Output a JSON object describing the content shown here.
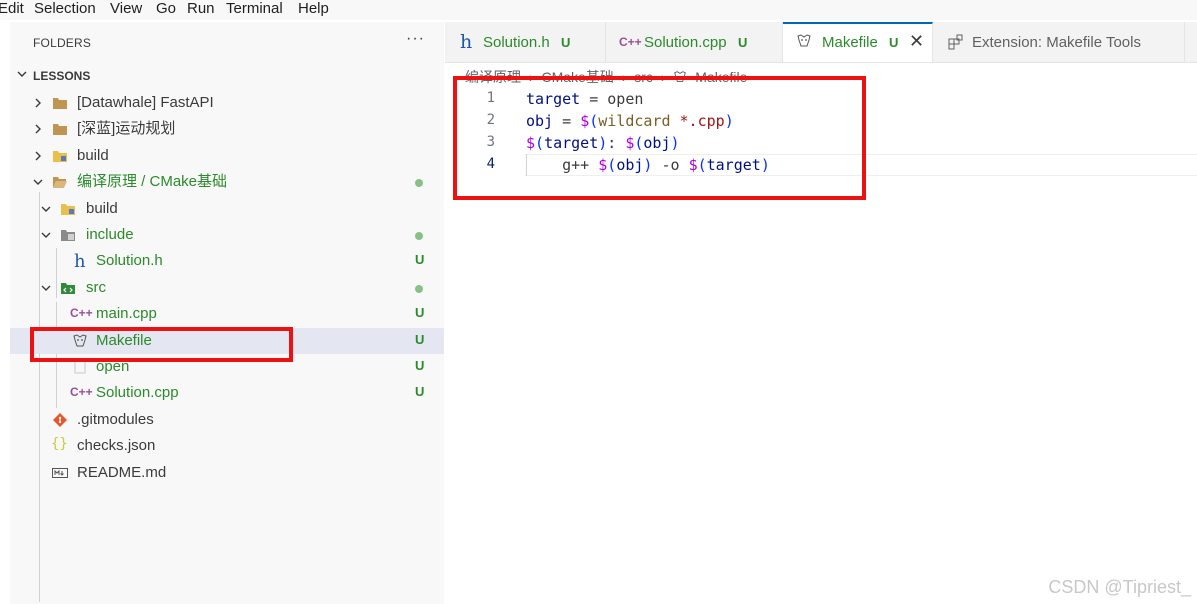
{
  "menu": [
    "Edit",
    "Selection",
    "View",
    "Go",
    "Run",
    "Terminal",
    "Help"
  ],
  "explorer": {
    "section_title": "FOLDERS",
    "more": "···",
    "workspace": "LESSONS",
    "items": [
      {
        "name": "[Datawhale] FastAPI",
        "icon": "folder-icon"
      },
      {
        "name": "[深蓝]运动规划",
        "icon": "folder-icon"
      },
      {
        "name": "build",
        "icon": "folder-build-icon"
      },
      {
        "name": "编译原理 / CMake基础",
        "icon": "folder-open-icon"
      },
      {
        "name": "build",
        "icon": "folder-build-icon"
      },
      {
        "name": "include",
        "icon": "folder-include-icon"
      },
      {
        "name": "Solution.h",
        "icon": "h-file-icon",
        "badge": "U"
      },
      {
        "name": "src",
        "icon": "folder-src-icon"
      },
      {
        "name": "main.cpp",
        "icon": "cpp-file-icon",
        "badge": "U"
      },
      {
        "name": "Makefile",
        "icon": "makefile-icon",
        "badge": "U"
      },
      {
        "name": "open",
        "icon": "file-icon",
        "badge": "U"
      },
      {
        "name": "Solution.cpp",
        "icon": "cpp-file-icon",
        "badge": "U"
      },
      {
        "name": ".gitmodules",
        "icon": "git-icon"
      },
      {
        "name": "checks.json",
        "icon": "json-icon"
      },
      {
        "name": "README.md",
        "icon": "markdown-icon"
      }
    ]
  },
  "tabs": [
    {
      "label": "Solution.h",
      "badge": "U"
    },
    {
      "label": "Solution.cpp",
      "badge": "U"
    },
    {
      "label": "Makefile",
      "badge": "U",
      "close": "✕"
    },
    {
      "label": "Extension: Makefile Tools"
    }
  ],
  "breadcrumb": [
    "编译原理",
    "CMake基础",
    "src",
    "Makefile"
  ],
  "breadcrumb_sep": "›",
  "editor": {
    "line_numbers": [
      "1",
      "2",
      "3",
      "4"
    ],
    "lines": [
      "target = open",
      "obj = $(wildcard *.cpp)",
      "$(target): $(obj)",
      "    g++ $(obj) -o $(target)"
    ]
  },
  "watermark": "CSDN @Tipriest_",
  "colors": {
    "accent": "#0066b8",
    "untracked": "#2c8a2c",
    "highlight": "#ee1111"
  }
}
